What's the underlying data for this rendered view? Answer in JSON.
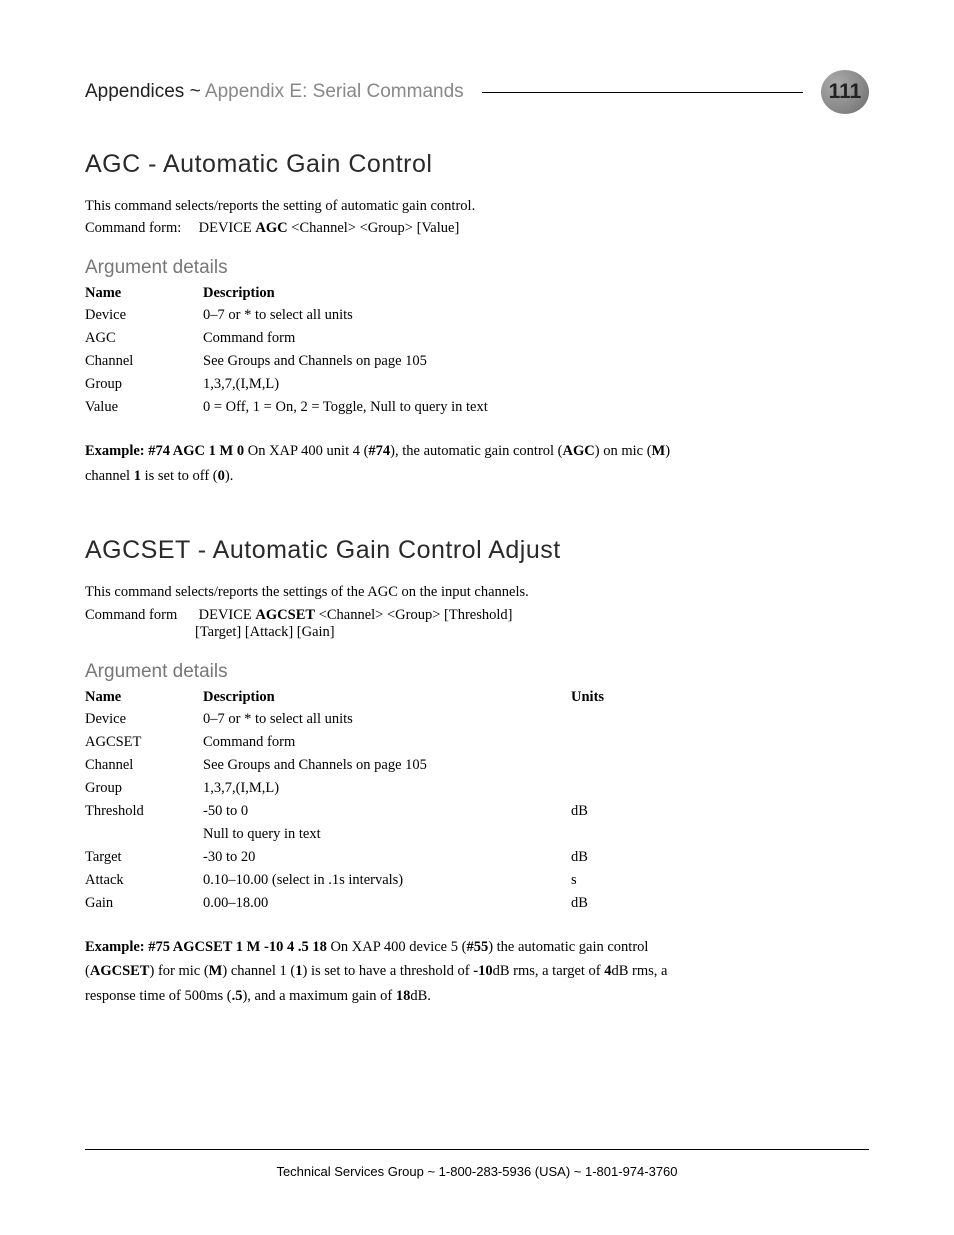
{
  "header": {
    "breadcrumb_strong": "Appendices ~ ",
    "breadcrumb_light": "Appendix E: Serial Commands",
    "page_number": "111"
  },
  "section1": {
    "title": "AGC - Automatic Gain Control",
    "intro": "This command selects/reports the setting of automatic gain control.",
    "cmd_label": "Command form:",
    "cmd_prefix": "DEVICE ",
    "cmd_bold": "AGC",
    "cmd_suffix": " <Channel> <Group> [Value]",
    "arg_title": "Argument details",
    "arg_head_name": "Name",
    "arg_head_desc": "Description",
    "args": [
      {
        "name": "Device",
        "desc": "0–7 or * to select all units"
      },
      {
        "name": "AGC",
        "desc": "Command form"
      },
      {
        "name": "Channel",
        "desc": "See Groups and Channels on page 105"
      },
      {
        "name": "Group",
        "desc": "1,3,7,(I,M,L)"
      },
      {
        "name": "Value",
        "desc": "0 = Off,  1 = On,  2 = Toggle,  Null to query in text"
      }
    ],
    "example": {
      "lead": "Example: #74 AGC 1 M 0",
      "p1a": "  On XAP 400 unit 4 (",
      "p1b": "#74",
      "p1c": "), the automatic gain control (",
      "p2a": "AGC",
      "p2b": ") on mic (",
      "p2c": "M",
      "p2d": ") channel ",
      "p2e": "1",
      "p2f": " is set to off (",
      "p2g": "0",
      "p2h": ")."
    }
  },
  "section2": {
    "title": "AGCSET - Automatic Gain Control Adjust",
    "intro": "This command selects/reports the settings of the AGC on the input channels.",
    "cmd_label": "Command form",
    "cmd_prefix": "DEVICE ",
    "cmd_bold": "AGCSET",
    "cmd_suffix": " <Channel> <Group> [Threshold]",
    "cmd_line2": "[Target] [Attack] [Gain]",
    "arg_title": "Argument details",
    "arg_head_name": "Name",
    "arg_head_desc": "Description",
    "arg_head_units": "Units",
    "args": [
      {
        "name": "Device",
        "desc": "0–7 or * to select all units",
        "units": ""
      },
      {
        "name": "AGCSET",
        "desc": "Command form",
        "units": ""
      },
      {
        "name": "Channel",
        "desc": "See Groups and Channels on page 105",
        "units": ""
      },
      {
        "name": "Group",
        "desc": "1,3,7,(I,M,L)",
        "units": ""
      },
      {
        "name": "Threshold",
        "desc": "-50 to 0",
        "units": "dB"
      },
      {
        "name": "",
        "desc": "Null to query in text",
        "units": ""
      },
      {
        "name": "Target",
        "desc": "-30 to 20",
        "units": "dB"
      },
      {
        "name": "Attack",
        "desc": "0.10–10.00 (select in .1s intervals)",
        "units": "s"
      },
      {
        "name": "Gain",
        "desc": "0.00–18.00",
        "units": "dB"
      }
    ],
    "example": {
      "lead": "Example:  #75 AGCSET 1 M -10 4 .5 18",
      "p1a": "  On XAP 400 device 5 (",
      "p1b": "#55",
      "p1c": ") the automatic gain control (",
      "p2a": "AGCSET",
      "p2b": ") for mic (",
      "p2c": "M",
      "p2d": ") channel 1 (",
      "p2e": "1",
      "p2f": ") is set to have a threshold of ",
      "p3a": "-10",
      "p3b": "dB rms, a target of ",
      "p3c": "4",
      "p3d": "dB rms, a response time of 500ms (",
      "p3e": ".5",
      "p3f": "), and a maximum gain of ",
      "p3g": "18",
      "p3h": "dB."
    }
  },
  "footer": {
    "text": "Technical Services Group ~ 1-800-283-5936 (USA) ~ 1-801-974-3760"
  }
}
